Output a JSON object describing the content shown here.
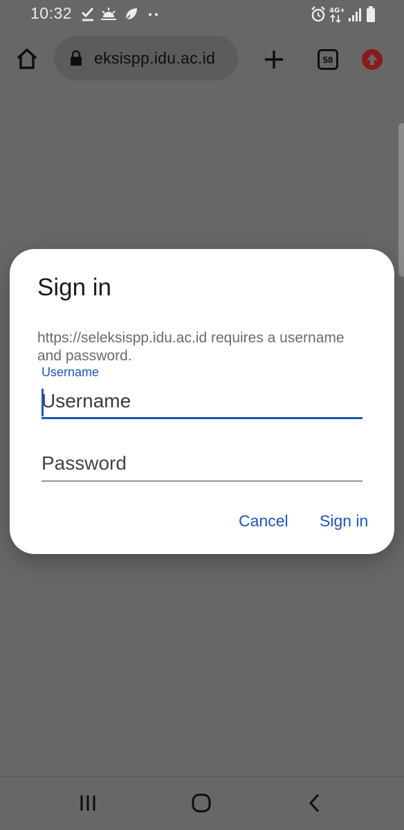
{
  "status_bar": {
    "time": "10:32",
    "left_icons": [
      "check-icon",
      "sunrise-icon",
      "leaf-icon",
      "dots-icon"
    ],
    "right_icons": [
      "alarm-icon",
      "network-4g-icon",
      "signal-icon",
      "battery-icon"
    ],
    "network_label": "4G+"
  },
  "toolbar": {
    "url": "eksispp.idu.ac.id",
    "tab_count": "58",
    "accent": "#8b1a1a"
  },
  "dialog": {
    "title": "Sign in",
    "message": "https://seleksispp.idu.ac.id requires a username and password.",
    "username_label": "Username",
    "username_placeholder": "Username",
    "password_placeholder": "Password",
    "cancel_label": "Cancel",
    "signin_label": "Sign in",
    "accent": "#1a56b8"
  },
  "nav_bar": {
    "buttons": [
      "recents-icon",
      "home-icon",
      "back-icon"
    ]
  }
}
